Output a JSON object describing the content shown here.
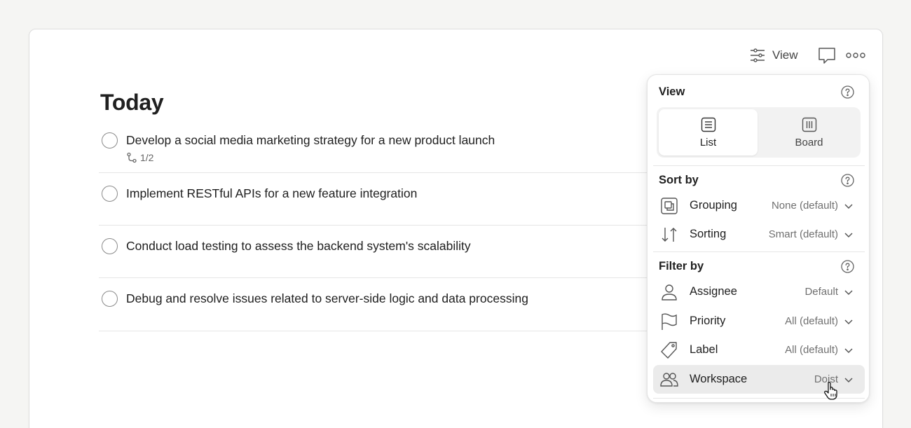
{
  "header": {
    "view_label": "View",
    "view_icon": "sliders-icon",
    "comment_icon": "comment-icon",
    "more_icon": "more-horizontal-icon"
  },
  "page": {
    "title": "Today"
  },
  "tasks": [
    {
      "text": "Develop a social media marketing strategy for a new product launch",
      "subtasks": "1/2"
    },
    {
      "text": "Implement RESTful APIs for a new feature integration"
    },
    {
      "text": "Conduct load testing to assess the backend system's scalability"
    },
    {
      "text": "Debug and resolve issues related to server-side logic and data processing"
    }
  ],
  "view_panel": {
    "title": "View",
    "layouts": [
      {
        "label": "List",
        "icon": "list-icon",
        "selected": true
      },
      {
        "label": "Board",
        "icon": "board-icon",
        "selected": false
      }
    ],
    "sort_title": "Sort by",
    "sort": [
      {
        "label": "Grouping",
        "value": "None (default)",
        "icon": "grouping-icon"
      },
      {
        "label": "Sorting",
        "value": "Smart (default)",
        "icon": "sort-arrows-icon"
      }
    ],
    "filter_title": "Filter by",
    "filters": [
      {
        "label": "Assignee",
        "value": "Default",
        "icon": "person-icon"
      },
      {
        "label": "Priority",
        "value": "All (default)",
        "icon": "flag-icon"
      },
      {
        "label": "Label",
        "value": "All (default)",
        "icon": "tag-icon"
      },
      {
        "label": "Workspace",
        "value": "Doist",
        "icon": "people-icon",
        "hovered": true
      }
    ]
  }
}
